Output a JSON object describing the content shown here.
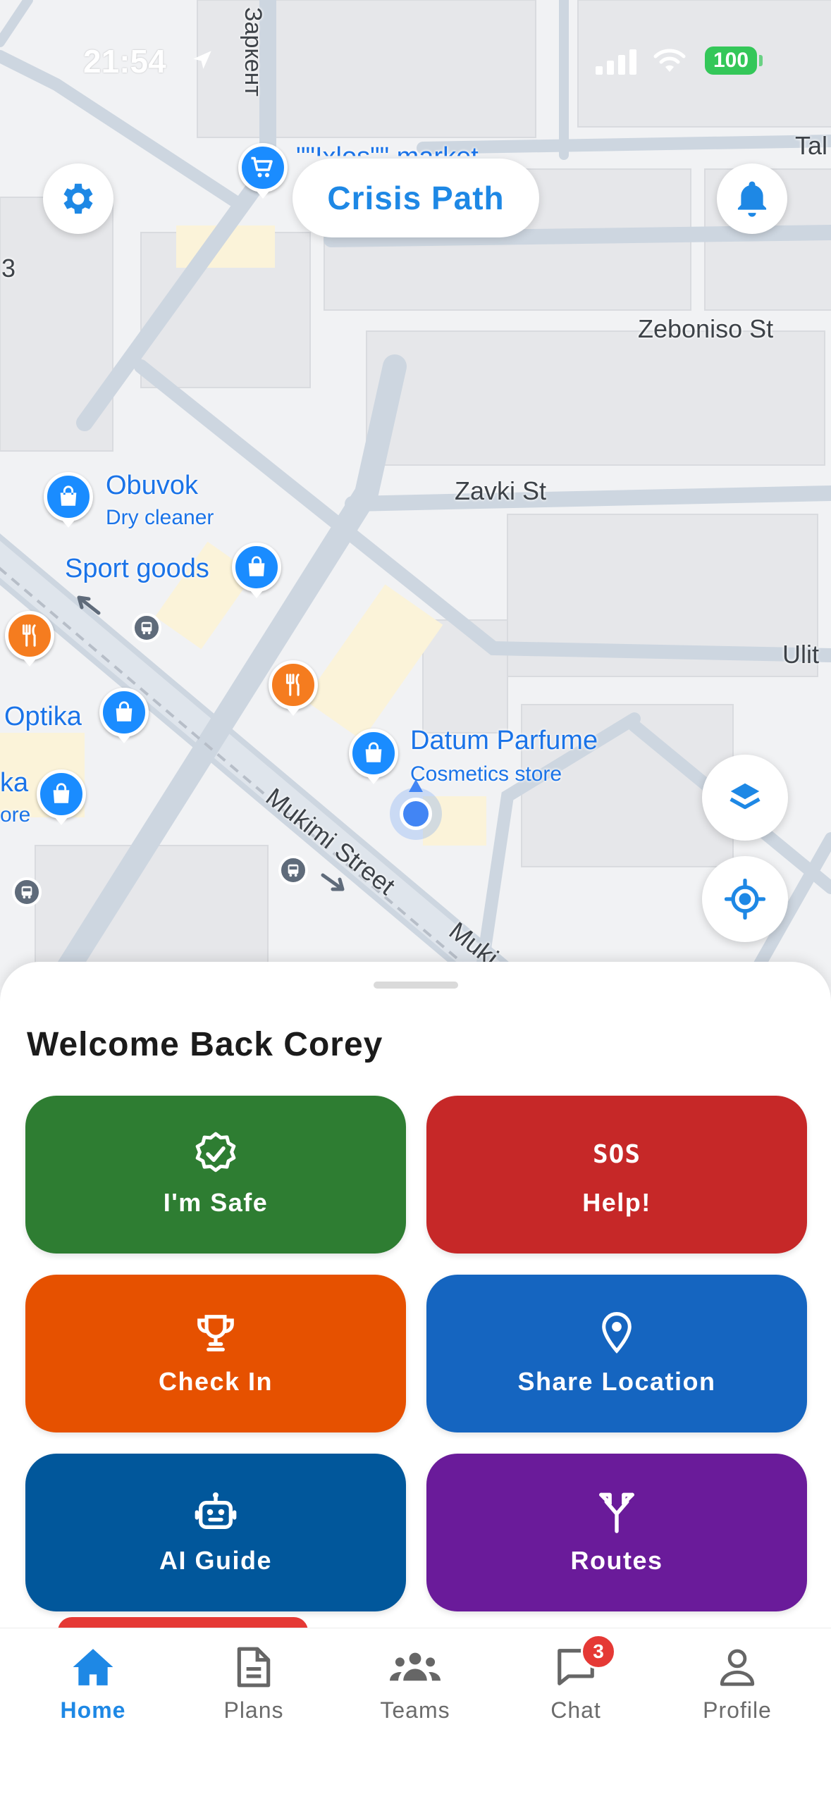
{
  "status_bar": {
    "time": "21:54",
    "battery": "100"
  },
  "header": {
    "app_title": "Crisis Path"
  },
  "map": {
    "streets": [
      "Заркент",
      "Zeboniso St",
      "Zavki St",
      "Mukimi Street",
      "Muki",
      "Tal",
      "Ulit",
      "3"
    ],
    "pois": [
      {
        "name": "\"\"Ixlos\"\" market",
        "category": ""
      },
      {
        "name": "Obuvok",
        "category": "Dry cleaner"
      },
      {
        "name": "Sport goods",
        "category": ""
      },
      {
        "name": "Optika",
        "category": ""
      },
      {
        "name": "ka",
        "category": "ore"
      },
      {
        "name": "Datum Parfume",
        "category": "Cosmetics store"
      }
    ]
  },
  "sheet": {
    "greeting": "Welcome Back Corey",
    "actions": [
      {
        "label": "I'm Safe",
        "icon": "verified-badge-icon",
        "color": "#2e7d32"
      },
      {
        "label": "Help!",
        "icon": "sos-icon",
        "icon_text": "SOS",
        "color": "#c62828"
      },
      {
        "label": "Check In",
        "icon": "trophy-icon",
        "color": "#e65100"
      },
      {
        "label": "Share Location",
        "icon": "location-pin-icon",
        "color": "#1565c0"
      },
      {
        "label": "AI Guide",
        "icon": "robot-icon",
        "color": "#01579b"
      },
      {
        "label": "Routes",
        "icon": "fork-arrows-icon",
        "color": "#6a1b9a"
      }
    ]
  },
  "tabbar": {
    "tabs": [
      {
        "label": "Home",
        "icon": "home-icon",
        "active": true
      },
      {
        "label": "Plans",
        "icon": "document-icon",
        "active": false
      },
      {
        "label": "Teams",
        "icon": "group-icon",
        "active": false
      },
      {
        "label": "Chat",
        "icon": "chat-icon",
        "active": false,
        "badge": "3"
      },
      {
        "label": "Profile",
        "icon": "person-icon",
        "active": false
      }
    ]
  },
  "colors": {
    "accent": "#1e88e5",
    "badge": "#e53935"
  }
}
